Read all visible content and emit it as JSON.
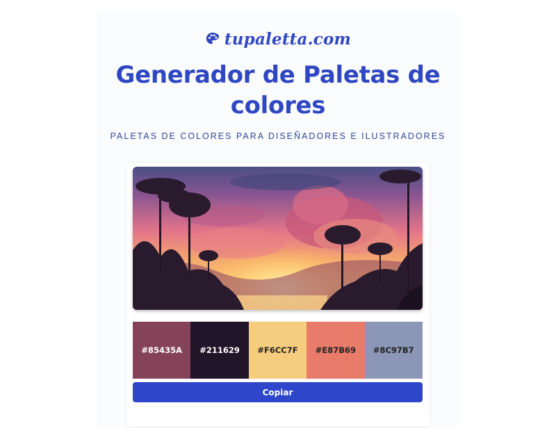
{
  "brand": {
    "name": "tupaletta.com",
    "icon": "palette-icon",
    "color": "#2f47c2"
  },
  "header": {
    "title": "Generador de Paletas de colores",
    "subtitle": "PALETAS DE COLORES PARA DISEÑADORES E ILUSTRADORES"
  },
  "artwork": {
    "description_icon": "sunset-jungle-illustration"
  },
  "palette": {
    "swatches": [
      {
        "hex": "#85435A",
        "label": "#85435A",
        "text_color": "#ffffff"
      },
      {
        "hex": "#211629",
        "label": "#211629",
        "text_color": "#ffffff"
      },
      {
        "hex": "#F6CC7F",
        "label": "#F6CC7F",
        "text_color": "#222222"
      },
      {
        "hex": "#E87B69",
        "label": "#E87B69",
        "text_color": "#222222"
      },
      {
        "hex": "#8C97B7",
        "label": "#8C97B7",
        "text_color": "#222222"
      }
    ]
  },
  "actions": {
    "copy_label": "Copiar",
    "accent": "#2e46c9"
  }
}
